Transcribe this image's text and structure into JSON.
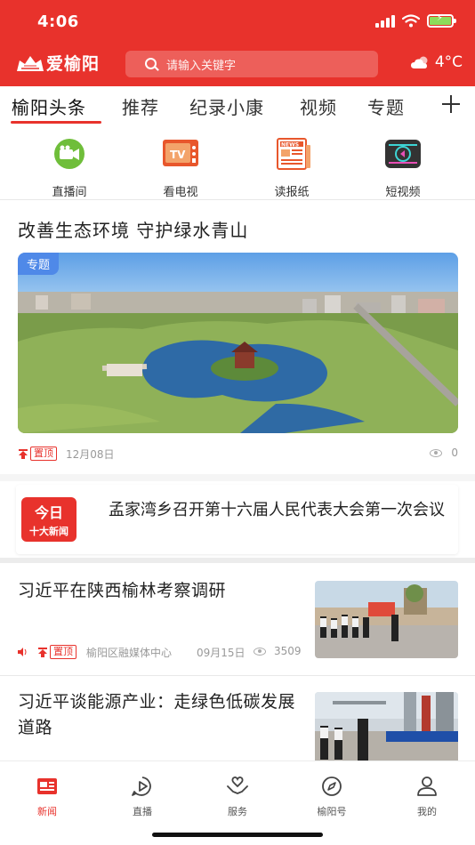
{
  "status": {
    "time": "4:06"
  },
  "header": {
    "app_name": "爱榆阳",
    "search_placeholder": "请输入关键字",
    "weather_temp": "4°C",
    "weather_icon": "cloud-sun-icon"
  },
  "tabs": [
    {
      "label": "榆阳头条",
      "active": true
    },
    {
      "label": "推荐"
    },
    {
      "label": "纪录小康"
    },
    {
      "label": "视频"
    },
    {
      "label": "专题"
    }
  ],
  "quick_entries": [
    {
      "label": "直播间",
      "icon": "live-camera-icon"
    },
    {
      "label": "看电视",
      "icon": "tv-icon"
    },
    {
      "label": "读报纸",
      "icon": "newspaper-icon"
    },
    {
      "label": "短视频",
      "icon": "short-video-icon"
    }
  ],
  "feature": {
    "title": "改善生态环境  守护绿水青山",
    "tag": "专题",
    "pinned_label": "置顶",
    "date": "12月08日",
    "views": "0"
  },
  "banner": {
    "logo_line1": "今日",
    "logo_line2": "十大新闻",
    "text": "孟家湾乡召开第十六届人民代表大会第一次会议"
  },
  "news": [
    {
      "title": "习近平在陕西榆林考察调研",
      "pinned_label": "置顶",
      "source": "榆阳区融媒体中心",
      "date": "09月15日",
      "views": "3509"
    },
    {
      "title": "习近平谈能源产业：走绿色低碳发展道路"
    }
  ],
  "bottom_nav": [
    {
      "label": "新闻",
      "icon": "news-icon",
      "active": true
    },
    {
      "label": "直播",
      "icon": "play-circle-icon"
    },
    {
      "label": "服务",
      "icon": "heart-hands-icon"
    },
    {
      "label": "榆阳号",
      "icon": "compass-icon"
    },
    {
      "label": "我的",
      "icon": "user-icon"
    }
  ],
  "colors": {
    "brand_red": "#e8322c",
    "tag_blue": "#4f89e8"
  }
}
